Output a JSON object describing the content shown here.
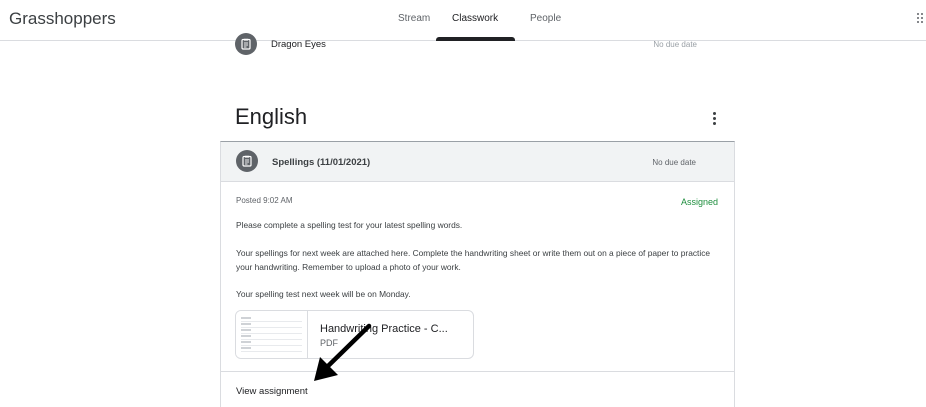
{
  "header": {
    "class_name": "Grasshoppers",
    "tabs": [
      {
        "label": "Stream",
        "active": false
      },
      {
        "label": "Classwork",
        "active": true
      },
      {
        "label": "People",
        "active": false
      }
    ],
    "apps_icon": "apps-grid-icon"
  },
  "previous_item": {
    "icon": "assignment-icon",
    "title": "Dragon Eyes",
    "due": "No due date"
  },
  "topic": {
    "title": "English",
    "menu_icon": "more-vert-icon"
  },
  "assignment": {
    "icon": "assignment-icon",
    "title": "Spellings (11/01/2021)",
    "due": "No due date",
    "posted": "Posted 9:02 AM",
    "status": "Assigned",
    "description": [
      "Please complete a spelling test for your latest spelling words.",
      "Your spellings for next week are attached here. Complete the handwriting sheet or write them out on a piece of paper to practice your handwriting. Remember to upload a photo of your work.",
      "Your spelling test next week will be on Monday."
    ],
    "attachment": {
      "title": "Handwriting Practice - C...",
      "type": "PDF"
    },
    "view_label": "View assignment"
  },
  "colors": {
    "status_green": "#1e8e3e",
    "tab_indicator": "#202124",
    "icon_bg": "#5f6368"
  }
}
